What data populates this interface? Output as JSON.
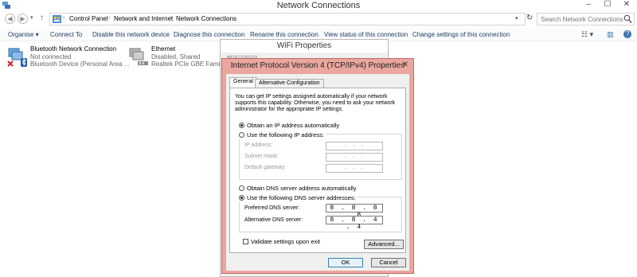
{
  "window": {
    "title": "Network Connections",
    "minimize": "–",
    "maximize": "☐",
    "close": "✕"
  },
  "nav": {
    "back": "◀",
    "forward": "▶",
    "up": "↑",
    "dropdown": "▾",
    "refresh": "↻"
  },
  "breadcrumb": {
    "items": [
      "Control Panel",
      "Network and Internet",
      "Network Connections"
    ],
    "separator": "›"
  },
  "search": {
    "placeholder": "Search Network Connections"
  },
  "toolbar": {
    "items": [
      "Organise ▾",
      "Connect To",
      "Disable this network device",
      "Diagnose this connection",
      "Rename this connection",
      "View status of this connection",
      "Change settings of this connection"
    ],
    "view_icon": "☷ ▾",
    "pane_icon": "▥",
    "help_icon": "?"
  },
  "adapters": [
    {
      "name": "Bluetooth Network Connection",
      "status": "Not connected",
      "device": "Bluetooth Device (Personal Area ..."
    },
    {
      "name": "Ethernet",
      "status": "Disabled, Shared",
      "device": "Realtek PCIe GBE Family Co"
    }
  ],
  "wifi_dialog": {
    "title": "WiFi Properties",
    "tab": "Networking"
  },
  "ipv4_dialog": {
    "title": "Internet Protocol Version 4 (TCP/IPv4) Properties",
    "close": "✕",
    "tabs": [
      "General",
      "Alternative Configuration"
    ],
    "description": "You can get IP settings assigned automatically if your network supports this capability. Otherwise, you need to ask your network administrator for the appropriate IP settings.",
    "ip_auto": "Obtain an IP address automatically",
    "ip_manual": "Use the following IP address:",
    "ip_fields": {
      "ip_address": "IP address:",
      "subnet_mask": "Subnet mask:",
      "default_gateway": "Default gateway:",
      "blank_value": ".     .     ."
    },
    "dns_auto": "Obtain DNS server address automatically",
    "dns_manual": "Use the following DNS server addresses:",
    "preferred_dns_label": "Preferred DNS server:",
    "preferred_dns_value": "8 . 8 . 8 . 8",
    "alternate_dns_label": "Alternative DNS server:",
    "alternate_dns_value": "8 . 8 . 4 . 4",
    "validate": "Validate settings upon exit",
    "advanced": "Advanced...",
    "ok": "OK",
    "cancel": "Cancel",
    "selected": {
      "ip": "auto",
      "dns": "manual"
    }
  },
  "colors": {
    "dialog_frame": "#e9a79f",
    "toolbar_text": "#1e395b"
  }
}
